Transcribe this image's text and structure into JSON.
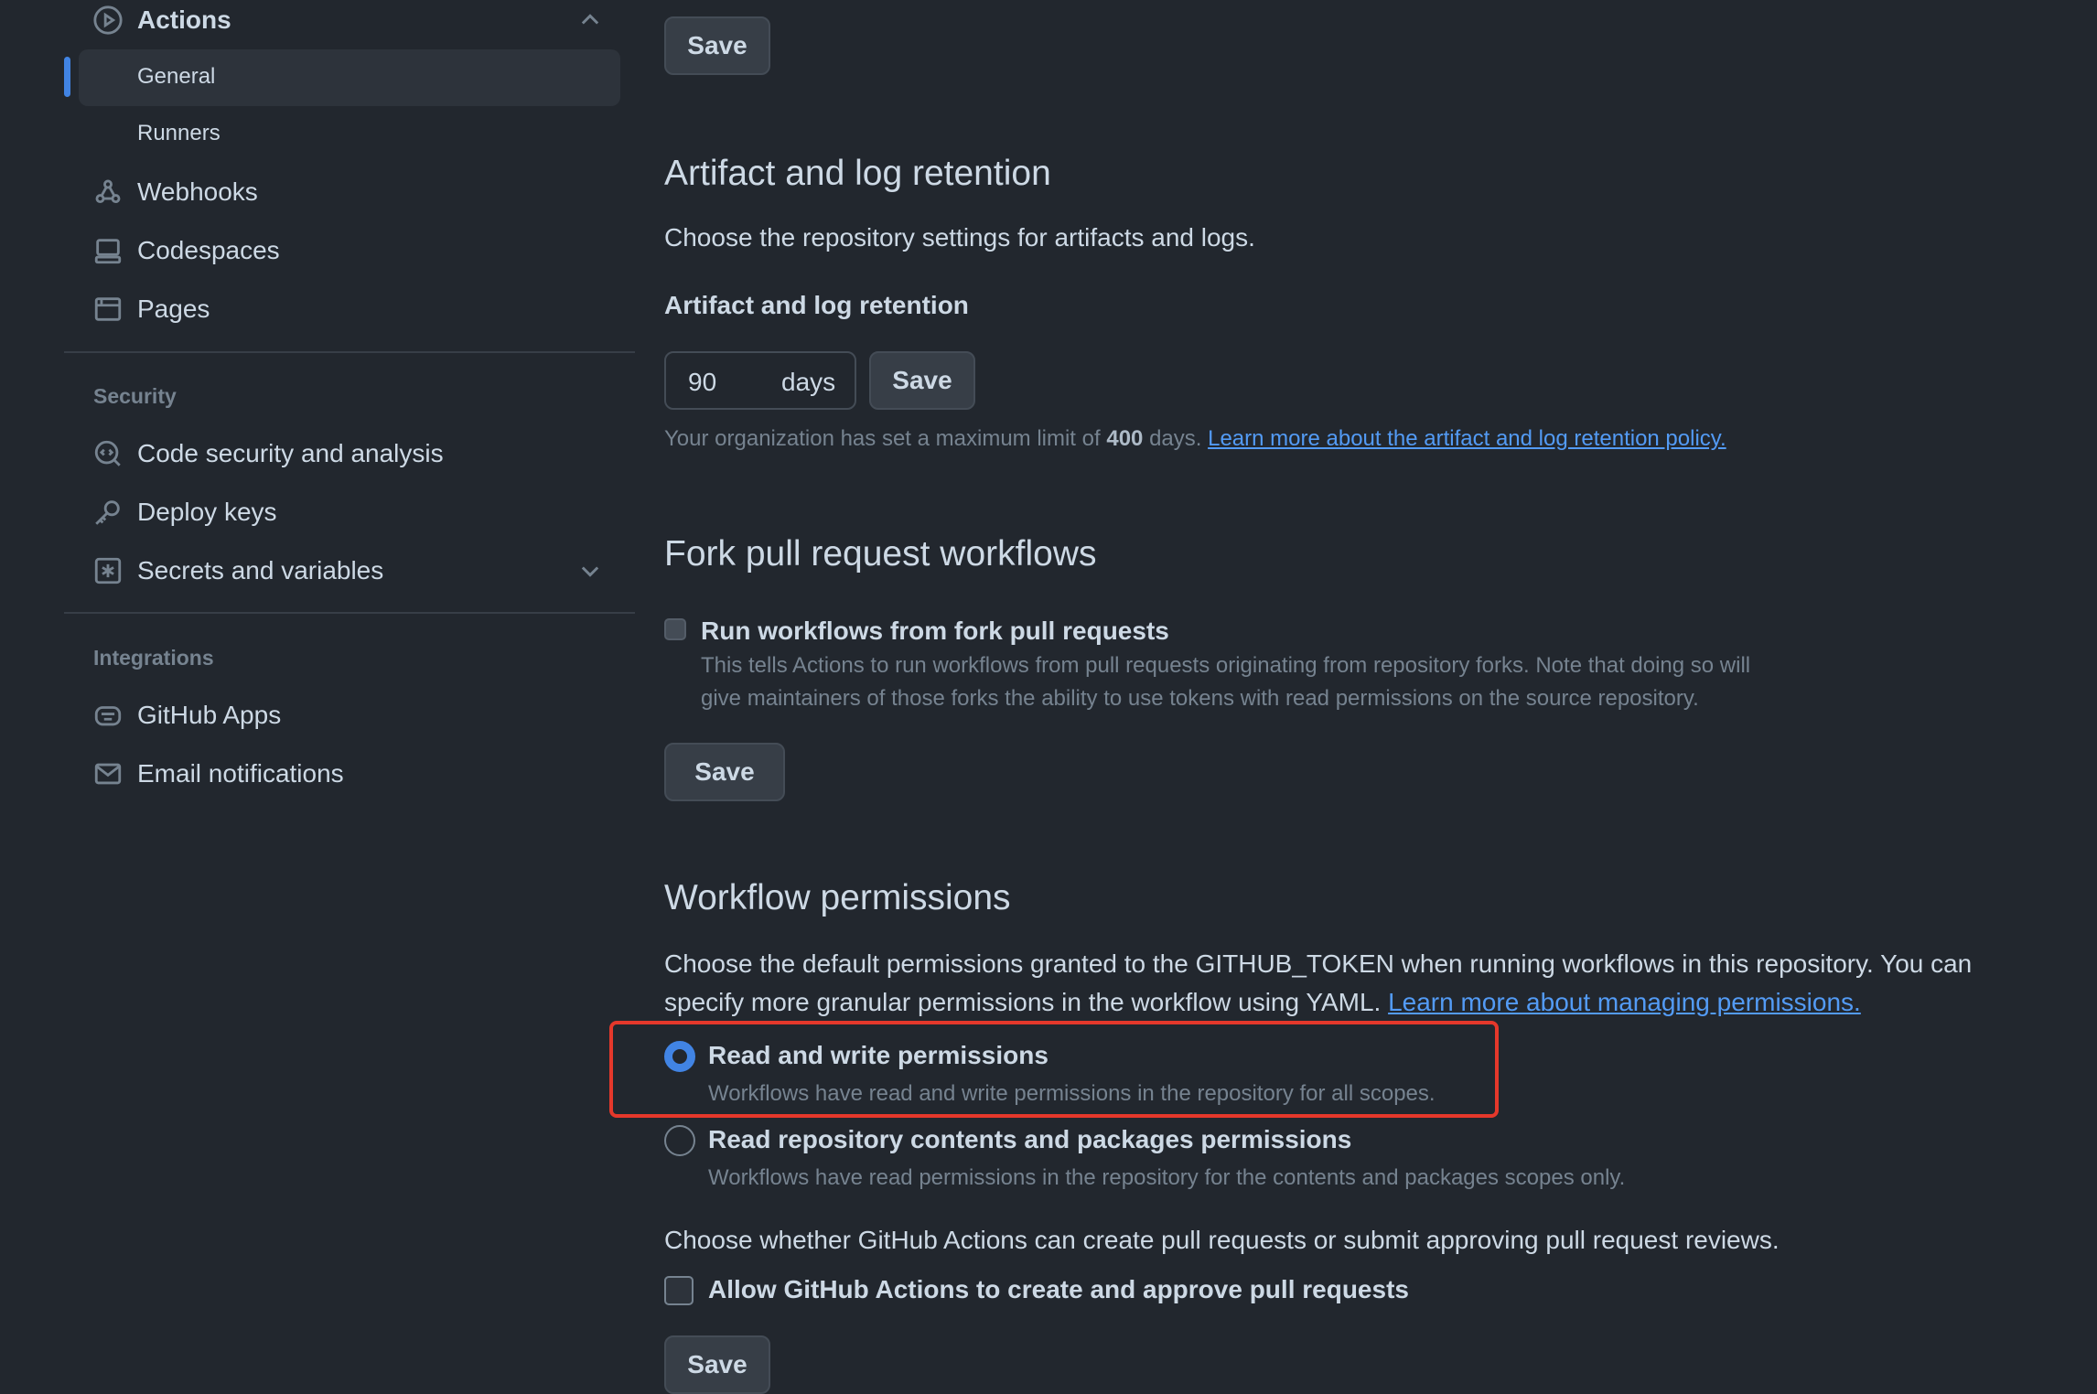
{
  "sidebar": {
    "actions_label": "Actions",
    "sub_items": [
      "General",
      "Runners"
    ],
    "items_top": [
      "Webhooks",
      "Codespaces",
      "Pages"
    ],
    "security_heading": "Security",
    "security_items": [
      "Code security and analysis",
      "Deploy keys",
      "Secrets and variables"
    ],
    "integrations_heading": "Integrations",
    "integration_items": [
      "GitHub Apps",
      "Email notifications"
    ],
    "active_accent": "#4184e4"
  },
  "top_save": "Save",
  "artifact": {
    "title": "Artifact and log retention",
    "description": "Choose the repository settings for artifacts and logs.",
    "field_label": "Artifact and log retention",
    "days_value": "90",
    "days_unit": "days",
    "save": "Save",
    "note_prefix": "Your organization has set a maximum limit of",
    "note_limit": "400",
    "note_suffix": "days.",
    "note_link": "Learn more about the artifact and log retention policy."
  },
  "fork": {
    "title": "Fork pull request workflows",
    "checkbox_label": "Run workflows from fork pull requests",
    "help_line1": "This tells Actions to run workflows from pull requests originating from repository forks. Note that doing so will",
    "help_line2": "give maintainers of those forks the ability to use tokens with read permissions on the source repository.",
    "save": "Save",
    "checked": false
  },
  "workflow": {
    "title": "Workflow permissions",
    "desc_line1": "Choose the default permissions granted to the GITHUB_TOKEN when running workflows in this repository. You can",
    "desc_line2_prefix": "specify more granular permissions in the workflow using YAML.",
    "desc_link": "Learn more about managing permissions.",
    "options": [
      {
        "label": "Read and write permissions",
        "help": "Workflows have read and write permissions in the repository for all scopes.",
        "selected": true
      },
      {
        "label": "Read repository contents and packages permissions",
        "help": "Workflows have read permissions in the repository for the contents and packages scopes only.",
        "selected": false
      }
    ],
    "pr_question": "Choose whether GitHub Actions can create pull requests or submit approving pull request reviews.",
    "allow_label": "Allow GitHub Actions to create and approve pull requests",
    "allow_checked": false,
    "save": "Save",
    "highlight_color": "#e5382b"
  }
}
